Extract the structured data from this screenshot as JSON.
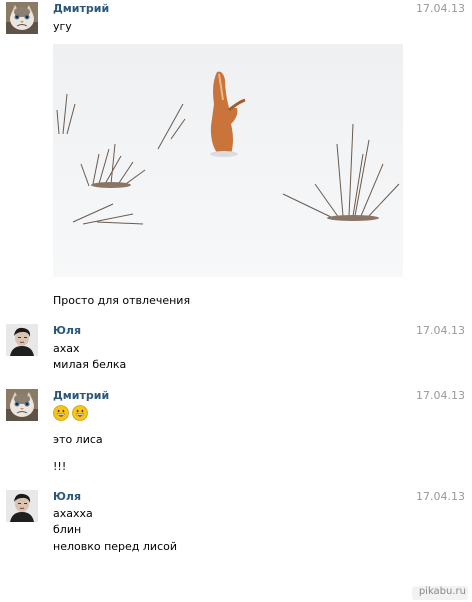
{
  "messages": [
    {
      "author": "Дмитрий",
      "date": "17.04.13",
      "lines": [
        "угу"
      ],
      "photo_icon": "fox-in-snow-photo",
      "caption": "Просто для отвлечения"
    },
    {
      "author": "Юля",
      "date": "17.04.13",
      "lines": [
        "ахах",
        "милая белка"
      ]
    },
    {
      "author": "Дмитрий",
      "date": "17.04.13",
      "emoji_icons": [
        "grinning-smiley-icon",
        "grinning-smiley-icon"
      ],
      "lines": [
        "это лиса",
        "!!!"
      ]
    },
    {
      "author": "Юля",
      "date": "17.04.13",
      "lines": [
        "ахахха",
        "блин",
        "неловко перед лисой"
      ]
    }
  ],
  "watermark": "pikabu.ru",
  "colors": {
    "author": "#2b587a",
    "date": "#999999",
    "text": "#000000",
    "background": "#ffffff"
  }
}
